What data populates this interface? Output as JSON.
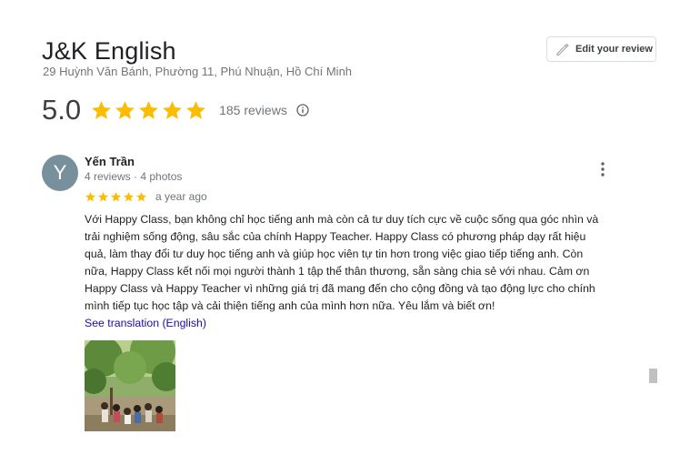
{
  "place": {
    "name": "J&K English",
    "address": "29 Huỳnh Văn Bánh, Phường 11, Phú Nhuận, Hồ Chí Minh"
  },
  "edit_review_label": "Edit your review",
  "rating": {
    "score": "5.0",
    "stars": 5,
    "reviews_label": "185 reviews"
  },
  "review": {
    "avatar_letter": "Y",
    "reviewer_name": "Yến Trần",
    "reviewer_meta": "4 reviews · 4 photos",
    "stars": 5,
    "date": "a year ago",
    "text_lines": [
      "Với Happy Class, bạn không chỉ học tiếng anh mà còn cả tư duy tích cực về cuộc sống qua góc nhìn và",
      "trải nghiệm sống động, sâu sắc của chính Happy Teacher. Happy Class có phương pháp dạy rất hiệu",
      "quả, làm thay đổi tư duy học tiếng anh và giúp học viên tự tin hơn trong việc giao tiếp tiếng anh. Còn",
      "nữa, Happy Class kết nối mọi người thành 1 tập thể thân thương, sẵn sàng chia sẻ với nhau. Cảm ơn",
      "Happy Class và Happy Teacher vì những giá trị đã mang đến cho cộng đồng và tạo động lực cho chính",
      "mình tiếp tục học tập và cải thiện tiếng anh của mình hơn nữa. Yêu lắm và biết ơn!"
    ],
    "translation_link": "See translation (English)"
  },
  "colors": {
    "star": "#fbbc04",
    "avatar_bg": "#78909c",
    "link": "#1a0dab"
  },
  "icons": {
    "edit": "pencil-icon",
    "info": "info-icon",
    "more": "more-vert-icon",
    "star": "star-icon"
  }
}
